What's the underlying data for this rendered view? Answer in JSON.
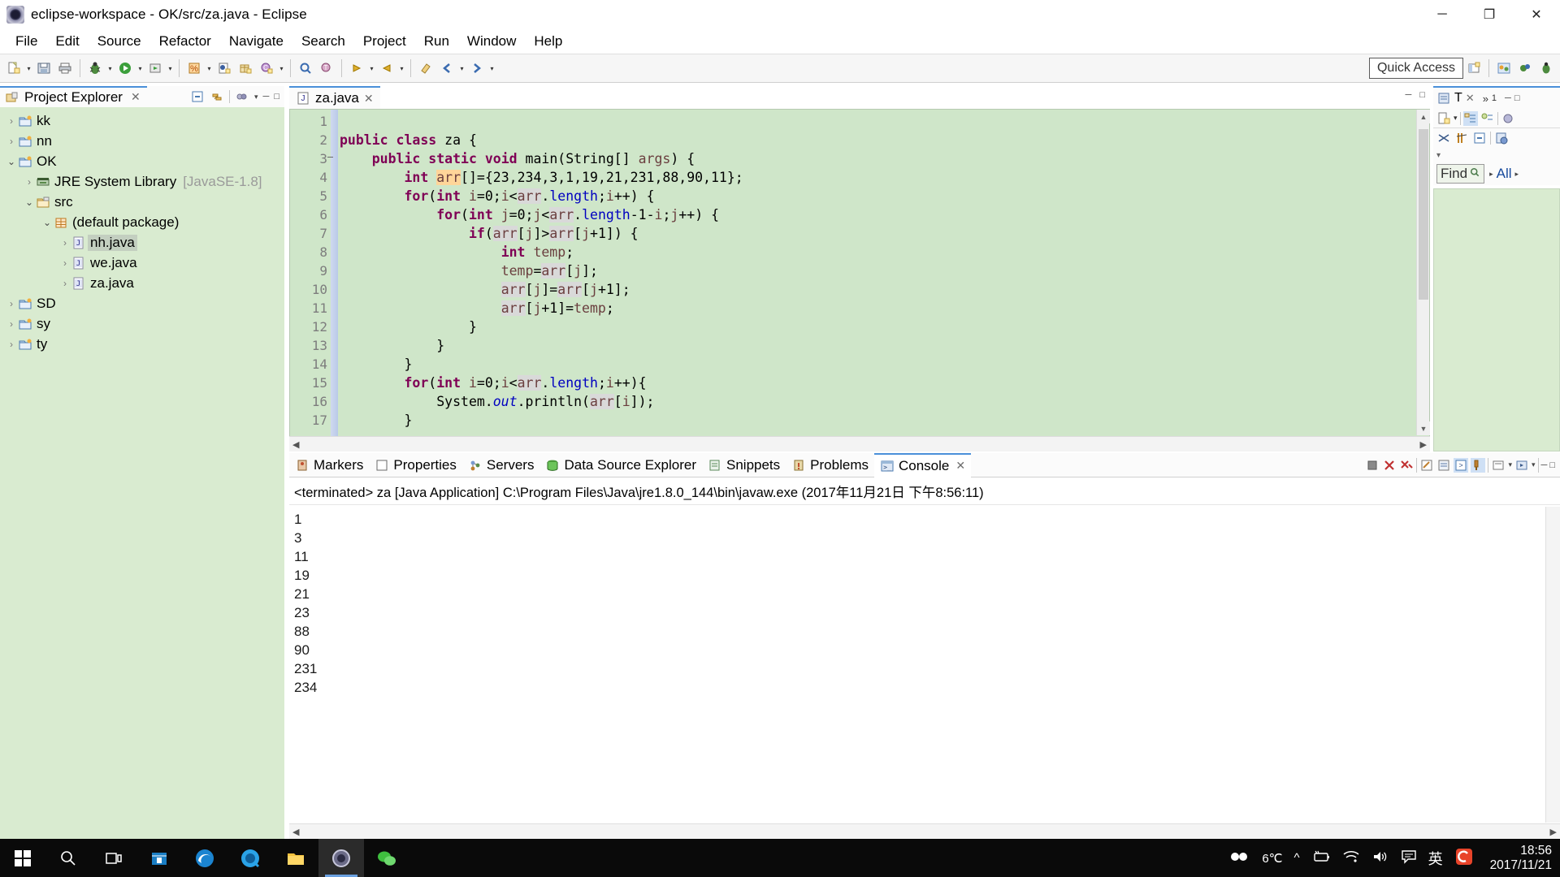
{
  "window": {
    "title": "eclipse-workspace - OK/src/za.java - Eclipse",
    "minimize": "─",
    "maximize": "❐",
    "close": "✕"
  },
  "menubar": [
    "File",
    "Edit",
    "Source",
    "Refactor",
    "Navigate",
    "Search",
    "Project",
    "Run",
    "Window",
    "Help"
  ],
  "toolbar": {
    "quick_access": "Quick Access"
  },
  "project_explorer": {
    "tab_label": "Project Explorer",
    "close": "✕",
    "tree": [
      {
        "label": "kk",
        "indent": 1,
        "arrow": "›",
        "icon": "project-icon",
        "selected": false,
        "suffix": ""
      },
      {
        "label": "nn",
        "indent": 1,
        "arrow": "›",
        "icon": "project-icon",
        "selected": false,
        "suffix": ""
      },
      {
        "label": "OK",
        "indent": 1,
        "arrow": "⌄",
        "icon": "project-icon",
        "selected": false,
        "suffix": ""
      },
      {
        "label": "JRE System Library",
        "indent": 2,
        "arrow": "›",
        "icon": "library-icon",
        "selected": false,
        "suffix": "[JavaSE-1.8]"
      },
      {
        "label": "src",
        "indent": 2,
        "arrow": "⌄",
        "icon": "source-folder-icon",
        "selected": false,
        "suffix": ""
      },
      {
        "label": "(default package)",
        "indent": 3,
        "arrow": "⌄",
        "icon": "package-icon",
        "selected": false,
        "suffix": ""
      },
      {
        "label": "nh.java",
        "indent": 4,
        "arrow": "›",
        "icon": "java-file-icon",
        "selected": true,
        "suffix": ""
      },
      {
        "label": "we.java",
        "indent": 4,
        "arrow": "›",
        "icon": "java-file-icon",
        "selected": false,
        "suffix": ""
      },
      {
        "label": "za.java",
        "indent": 4,
        "arrow": "›",
        "icon": "java-file-icon",
        "selected": false,
        "suffix": ""
      },
      {
        "label": "SD",
        "indent": 1,
        "arrow": "›",
        "icon": "project-icon",
        "selected": false,
        "suffix": ""
      },
      {
        "label": "sy",
        "indent": 1,
        "arrow": "›",
        "icon": "project-icon",
        "selected": false,
        "suffix": ""
      },
      {
        "label": "ty",
        "indent": 1,
        "arrow": "›",
        "icon": "project-icon",
        "selected": false,
        "suffix": ""
      }
    ]
  },
  "editor": {
    "tab_label": "za.java",
    "close": "✕",
    "line_numbers": [
      "1",
      "2",
      "3",
      "4",
      "5",
      "6",
      "7",
      "8",
      "9",
      "10",
      "11",
      "12",
      "13",
      "14",
      "15",
      "16",
      "17"
    ],
    "fold_lines": [
      3
    ],
    "code_lines": [
      "",
      "public class za {",
      "    public static void main(String[] args) {",
      "        int arr[]={23,234,3,1,19,21,231,88,90,11};",
      "        for(int i=0;i<arr.length;i++) {",
      "            for(int j=0;j<arr.length-1-i;j++) {",
      "                if(arr[j]>arr[j+1]) {",
      "                    int temp;",
      "                    temp=arr[j];",
      "                    arr[j]=arr[j+1];",
      "                    arr[j+1]=temp;",
      "                }",
      "            }",
      "        }",
      "        for(int i=0;i<arr.length;i++){",
      "            System.out.println(arr[i]);",
      "        }"
    ]
  },
  "right_pane": {
    "tab_label": "T",
    "close": "✕",
    "overflow": "»",
    "overflow_count": "1",
    "find_label": "Find",
    "all_label": "All"
  },
  "console": {
    "tabs": [
      {
        "label": "Markers",
        "icon": "markers-icon",
        "active": false
      },
      {
        "label": "Properties",
        "icon": "properties-icon",
        "active": false
      },
      {
        "label": "Servers",
        "icon": "servers-icon",
        "active": false
      },
      {
        "label": "Data Source Explorer",
        "icon": "data-source-icon",
        "active": false
      },
      {
        "label": "Snippets",
        "icon": "snippets-icon",
        "active": false
      },
      {
        "label": "Problems",
        "icon": "problems-icon",
        "active": false
      },
      {
        "label": "Console",
        "icon": "console-icon",
        "active": true
      }
    ],
    "close": "✕",
    "launch_header": "<terminated> za [Java Application] C:\\Program Files\\Java\\jre1.8.0_144\\bin\\javaw.exe (2017年11月21日 下午8:56:11)",
    "output": [
      "1",
      "3",
      "11",
      "19",
      "21",
      "23",
      "88",
      "90",
      "231",
      "234"
    ]
  },
  "taskbar": {
    "temperature": "6℃",
    "ime": "英",
    "time": "18:56",
    "date": "2017/11/21",
    "items": [
      {
        "name": "start-button",
        "icon": "windows-logo-icon"
      },
      {
        "name": "search-button",
        "icon": "search-icon"
      },
      {
        "name": "task-view-button",
        "icon": "task-view-icon"
      },
      {
        "name": "store-button",
        "icon": "store-icon"
      },
      {
        "name": "edge-button",
        "icon": "edge-icon"
      },
      {
        "name": "browser-button",
        "icon": "circle-browser-icon"
      },
      {
        "name": "explorer-button",
        "icon": "folder-icon"
      },
      {
        "name": "eclipse-button",
        "icon": "eclipse-icon"
      },
      {
        "name": "wechat-button",
        "icon": "wechat-icon"
      }
    ]
  },
  "colors": {
    "editor_bg": "#cfe6c9",
    "tree_bg": "#d9ebd0",
    "tab_accent": "#4a90d9",
    "keyword": "#7f0055",
    "field": "#0000c0",
    "taskbar": "#0a0a0a"
  }
}
